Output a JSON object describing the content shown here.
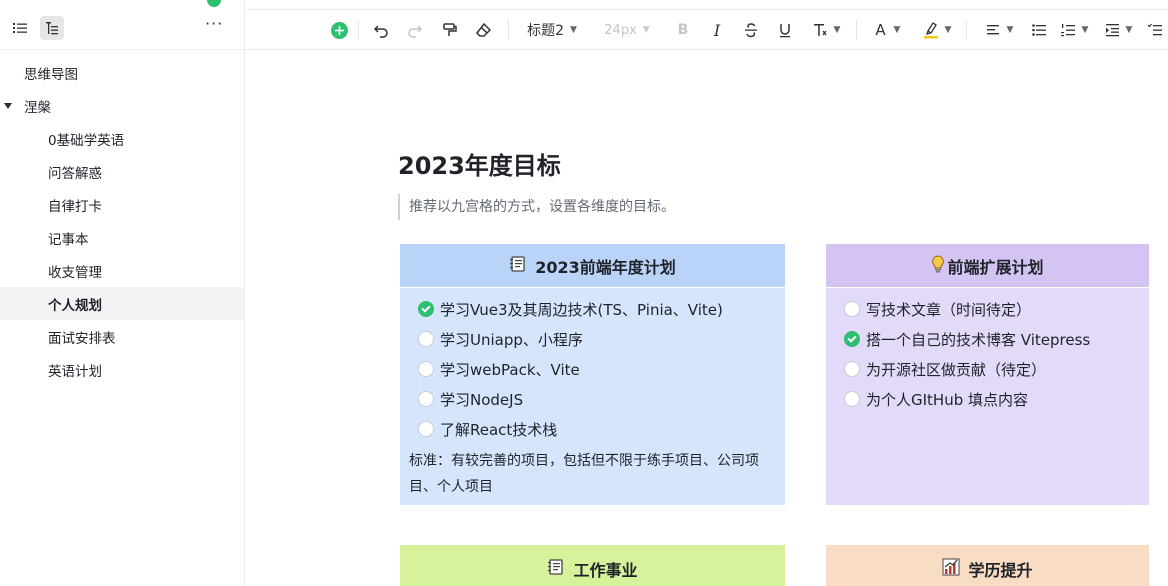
{
  "sidebar": {
    "toolbar": {
      "list_icon": "list-icon",
      "tree_icon": "outline-icon",
      "more_label": "···"
    },
    "items": [
      {
        "label": "思维导图",
        "level": 0
      },
      {
        "label": "涅槃",
        "level": 0,
        "expanded": true
      },
      {
        "label": "0基础学英语",
        "level": 1
      },
      {
        "label": "问答解惑",
        "level": 1
      },
      {
        "label": "自律打卡",
        "level": 1
      },
      {
        "label": "记事本",
        "level": 1
      },
      {
        "label": "收支管理",
        "level": 1
      },
      {
        "label": "个人规划",
        "level": 1,
        "selected": true
      },
      {
        "label": "面试安排表",
        "level": 1
      },
      {
        "label": "英语计划",
        "level": 1
      }
    ]
  },
  "toolbar": {
    "heading_style": "标题2",
    "font_size": "24px",
    "bold": "B",
    "italic": "I",
    "font_color_letter": "A",
    "accent": "#2fbf71"
  },
  "document": {
    "title": "2023年度目标",
    "subtitle": "推荐以九宫格的方式，设置各维度的目标。",
    "cards": {
      "frontend": {
        "title": "2023前端年度计划",
        "icon": "notebook-icon",
        "items": [
          {
            "text": "学习Vue3及其周边技术(TS、Pinia、Vite)",
            "checked": true
          },
          {
            "text": "学习Uniapp、小程序",
            "checked": false
          },
          {
            "text": "学习webPack、Vite",
            "checked": false
          },
          {
            "text": "学习NodeJS",
            "checked": false
          },
          {
            "text": "了解React技术栈",
            "checked": false
          }
        ],
        "note": "标准：有较完善的项目，包括但不限于练手项目、公司项目、个人项目",
        "color": "#d5e5fb"
      },
      "extension": {
        "title": "前端扩展计划",
        "icon": "lightbulb-icon",
        "items": [
          {
            "text": "写技术文章（时间待定）",
            "checked": false
          },
          {
            "text": "搭一个自己的技术博客 Vitepress",
            "checked": true
          },
          {
            "text": "为开源社区做贡献（待定）",
            "checked": false
          },
          {
            "text": "为个人GItHub 填点内容",
            "checked": false
          }
        ],
        "color": "#e3d9f8"
      },
      "career": {
        "title": "工作事业",
        "icon": "notebook-icon",
        "color": "#d8f29b"
      },
      "education": {
        "title": "学历提升",
        "icon": "chart-icon",
        "color": "#f9dcc4"
      }
    }
  }
}
